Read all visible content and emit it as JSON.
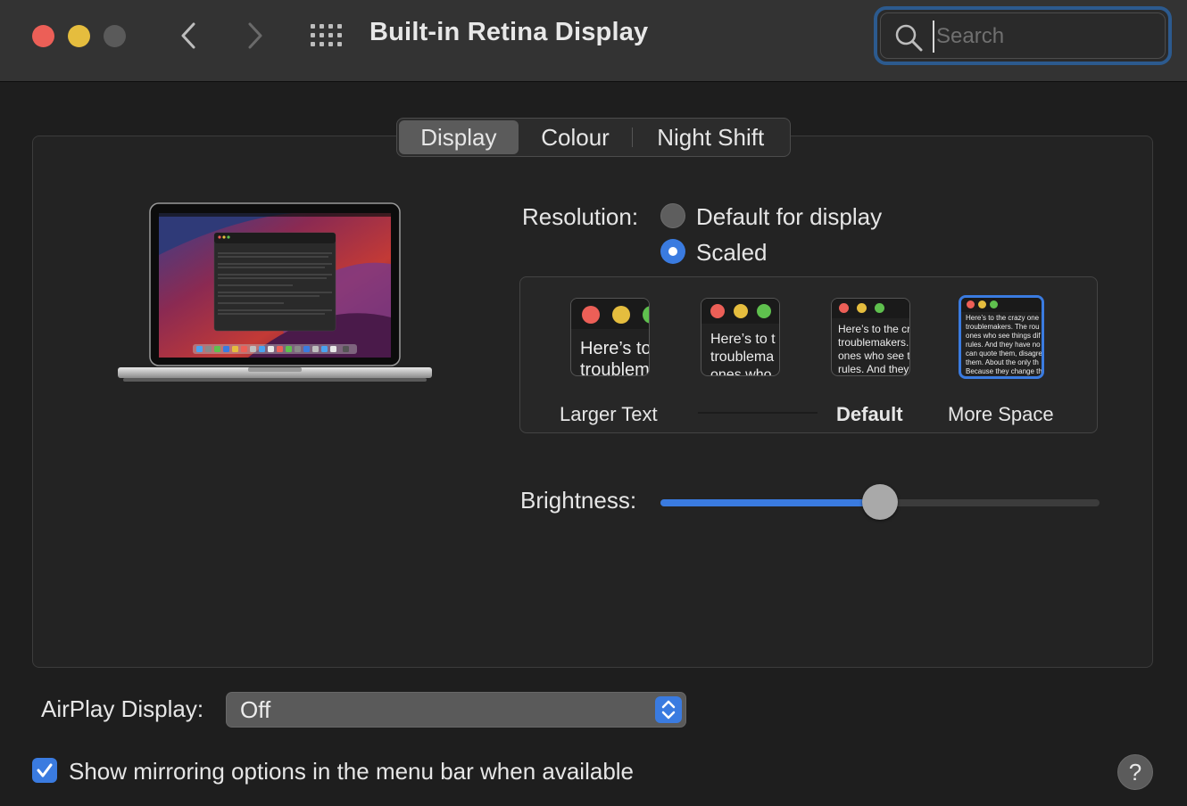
{
  "window": {
    "title": "Built-in Retina Display",
    "search_placeholder": "Search"
  },
  "tabs": [
    {
      "label": "Display",
      "active": true
    },
    {
      "label": "Colour",
      "active": false
    },
    {
      "label": "Night Shift",
      "active": false
    }
  ],
  "resolution": {
    "label": "Resolution:",
    "options": [
      {
        "label": "Default for display",
        "selected": false
      },
      {
        "label": "Scaled",
        "selected": true
      }
    ],
    "scale_options": [
      {
        "label": "Larger Text",
        "preview_lines": [
          "Here’s to",
          "troublem"
        ],
        "selected": false
      },
      {
        "label": "",
        "preview_lines": [
          "Here’s to t",
          "troublema",
          "ones who"
        ],
        "selected": false
      },
      {
        "label": "Default",
        "preview_lines": [
          "Here’s to the cr",
          "troublemakers.",
          "ones who see t",
          "rules. And they"
        ],
        "selected": false
      },
      {
        "label": "More Space",
        "preview_lines": [
          "Here’s to the crazy one",
          "troublemakers. The rou",
          "ones who see things dif",
          "rules. And they have no",
          "can quote them, disagre",
          "them. About the only th",
          "Because they change th"
        ],
        "selected": true
      }
    ]
  },
  "brightness": {
    "label": "Brightness:",
    "value": 0.5
  },
  "airplay": {
    "label": "AirPlay Display:",
    "value": "Off"
  },
  "mirroring": {
    "label": "Show mirroring options in the menu bar when available",
    "checked": true
  },
  "help_label": "?",
  "colors": {
    "accent": "#3a7be0",
    "close": "#ec5f57",
    "minimize": "#e5bd3e"
  }
}
